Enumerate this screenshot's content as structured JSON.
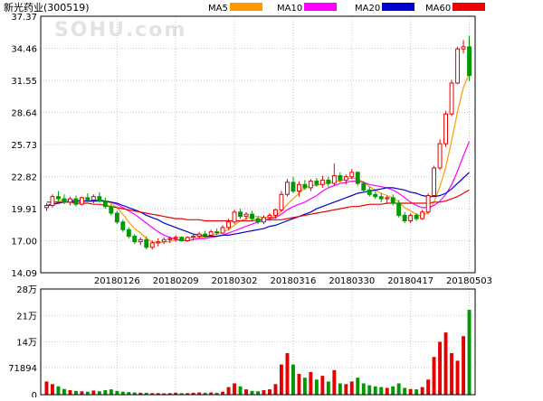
{
  "header": {
    "title": "新光药业(300519)",
    "watermark": "SOHU.com"
  },
  "legend": [
    {
      "label": "MA5",
      "color": "#ff9900"
    },
    {
      "label": "MA10",
      "color": "#ff00ff"
    },
    {
      "label": "MA20",
      "color": "#0000cc"
    },
    {
      "label": "MA60",
      "color": "#ee0000"
    }
  ],
  "colors": {
    "up": "#e60000",
    "down": "#009900",
    "grid": "#c8c8c8",
    "axis": "#000000",
    "background": "#ffffff"
  },
  "chart_data": [
    {
      "type": "candlestick",
      "title": "新光药业(300519)",
      "ylim": [
        14.09,
        37.37
      ],
      "y_ticks": [
        "37.37",
        "34.46",
        "31.55",
        "28.64",
        "25.73",
        "22.82",
        "19.91",
        "17.00",
        "14.09"
      ],
      "x_ticks": [
        {
          "index": 12,
          "label": "20180126"
        },
        {
          "index": 22,
          "label": "20180209"
        },
        {
          "index": 32,
          "label": "20180302"
        },
        {
          "index": 42,
          "label": "20180316"
        },
        {
          "index": 52,
          "label": "20180330"
        },
        {
          "index": 62,
          "label": "20180417"
        },
        {
          "index": 72,
          "label": "20180503"
        }
      ],
      "ohlc": [
        [
          20.0,
          20.4,
          19.7,
          20.2
        ],
        [
          20.2,
          21.2,
          20.0,
          21.0
        ],
        [
          21.0,
          21.5,
          20.6,
          20.8
        ],
        [
          20.8,
          21.2,
          20.3,
          20.5
        ],
        [
          20.5,
          21.0,
          20.2,
          20.8
        ],
        [
          20.8,
          21.1,
          20.1,
          20.3
        ],
        [
          20.3,
          21.0,
          20.2,
          20.9
        ],
        [
          20.9,
          21.3,
          20.5,
          20.7
        ],
        [
          20.7,
          21.2,
          20.4,
          21.0
        ],
        [
          21.0,
          21.4,
          20.5,
          20.6
        ],
        [
          20.6,
          20.9,
          19.9,
          20.1
        ],
        [
          20.1,
          20.3,
          19.3,
          19.5
        ],
        [
          19.5,
          19.7,
          18.5,
          18.7
        ],
        [
          18.7,
          18.9,
          17.8,
          18.0
        ],
        [
          18.0,
          18.2,
          17.2,
          17.4
        ],
        [
          17.4,
          17.6,
          16.7,
          16.9
        ],
        [
          16.9,
          17.3,
          16.6,
          17.1
        ],
        [
          17.1,
          17.4,
          16.2,
          16.4
        ],
        [
          16.4,
          17.0,
          16.2,
          16.8
        ],
        [
          16.8,
          17.2,
          16.5,
          16.9
        ],
        [
          16.9,
          17.3,
          16.7,
          17.1
        ],
        [
          17.1,
          17.4,
          16.8,
          17.2
        ],
        [
          17.2,
          17.5,
          16.9,
          17.3
        ],
        [
          17.3,
          17.4,
          16.9,
          17.0
        ],
        [
          17.0,
          17.4,
          16.9,
          17.3
        ],
        [
          17.3,
          17.6,
          17.1,
          17.4
        ],
        [
          17.4,
          17.8,
          17.2,
          17.6
        ],
        [
          17.6,
          17.9,
          17.3,
          17.5
        ],
        [
          17.5,
          18.0,
          17.4,
          17.8
        ],
        [
          17.8,
          18.1,
          17.5,
          17.7
        ],
        [
          17.7,
          18.4,
          17.6,
          18.2
        ],
        [
          18.2,
          19.0,
          18.0,
          18.7
        ],
        [
          18.7,
          19.8,
          18.5,
          19.6
        ],
        [
          19.6,
          19.9,
          19.0,
          19.2
        ],
        [
          19.2,
          19.6,
          18.9,
          19.4
        ],
        [
          19.4,
          19.7,
          18.8,
          19.0
        ],
        [
          19.0,
          19.2,
          18.5,
          18.7
        ],
        [
          18.7,
          19.3,
          18.5,
          19.1
        ],
        [
          19.1,
          19.5,
          18.8,
          19.3
        ],
        [
          19.3,
          19.9,
          19.0,
          19.8
        ],
        [
          19.8,
          21.5,
          19.6,
          21.2
        ],
        [
          21.2,
          22.6,
          21.0,
          22.3
        ],
        [
          22.3,
          22.8,
          21.3,
          21.5
        ],
        [
          21.5,
          22.4,
          21.0,
          22.1
        ],
        [
          22.1,
          22.5,
          21.6,
          21.8
        ],
        [
          21.8,
          22.6,
          21.5,
          22.4
        ],
        [
          22.4,
          22.7,
          21.9,
          22.1
        ],
        [
          22.1,
          22.9,
          21.8,
          22.5
        ],
        [
          22.5,
          22.8,
          21.9,
          22.2
        ],
        [
          22.2,
          24.0,
          22.0,
          22.9
        ],
        [
          22.9,
          23.2,
          22.3,
          22.5
        ],
        [
          22.5,
          23.0,
          22.1,
          22.8
        ],
        [
          22.8,
          23.5,
          22.6,
          23.2
        ],
        [
          23.2,
          23.3,
          22.0,
          22.2
        ],
        [
          22.2,
          22.4,
          21.4,
          21.6
        ],
        [
          21.6,
          21.9,
          21.0,
          21.2
        ],
        [
          21.2,
          21.5,
          20.8,
          21.0
        ],
        [
          21.0,
          21.3,
          20.5,
          20.8
        ],
        [
          20.8,
          21.1,
          20.4,
          20.9
        ],
        [
          20.9,
          21.2,
          20.2,
          20.4
        ],
        [
          20.4,
          20.7,
          19.1,
          19.3
        ],
        [
          19.3,
          19.6,
          18.6,
          18.8
        ],
        [
          18.8,
          19.5,
          18.6,
          19.3
        ],
        [
          19.3,
          19.5,
          18.8,
          19.0
        ],
        [
          19.0,
          19.8,
          18.9,
          19.6
        ],
        [
          19.6,
          21.3,
          19.4,
          21.1
        ],
        [
          21.1,
          23.8,
          21.0,
          23.6
        ],
        [
          23.6,
          26.2,
          23.4,
          25.8
        ],
        [
          25.8,
          28.8,
          25.5,
          28.5
        ],
        [
          28.5,
          31.6,
          28.3,
          31.3
        ],
        [
          31.3,
          34.6,
          31.2,
          34.4
        ],
        [
          34.4,
          35.2,
          34.0,
          34.6
        ],
        [
          34.6,
          35.6,
          31.5,
          32.0
        ]
      ],
      "ma": {
        "MA5": [
          20.1,
          20.4,
          20.6,
          20.7,
          20.7,
          20.7,
          20.6,
          20.6,
          20.7,
          20.7,
          20.6,
          20.4,
          20.0,
          19.4,
          18.7,
          18.1,
          17.7,
          17.2,
          16.9,
          16.8,
          16.9,
          16.9,
          17.1,
          17.1,
          17.2,
          17.3,
          17.3,
          17.3,
          17.5,
          17.6,
          17.8,
          18.0,
          18.4,
          18.8,
          19.0,
          19.2,
          19.2,
          19.1,
          19.1,
          19.2,
          19.7,
          20.3,
          20.8,
          21.3,
          21.8,
          22.0,
          22.0,
          22.2,
          22.2,
          22.4,
          22.4,
          22.6,
          22.7,
          22.6,
          22.3,
          21.9,
          21.6,
          21.3,
          21.1,
          20.9,
          20.5,
          20.0,
          19.7,
          19.4,
          19.2,
          19.6,
          20.5,
          21.9,
          23.7,
          26.1,
          28.7,
          30.9,
          32.2
        ],
        "MA10": [
          20.1,
          20.3,
          20.4,
          20.5,
          20.6,
          20.6,
          20.6,
          20.6,
          20.6,
          20.7,
          20.6,
          20.5,
          20.3,
          20.0,
          19.7,
          19.4,
          19.0,
          18.6,
          18.2,
          17.8,
          17.5,
          17.3,
          17.1,
          17.0,
          17.0,
          17.1,
          17.2,
          17.2,
          17.3,
          17.4,
          17.5,
          17.7,
          17.9,
          18.1,
          18.3,
          18.5,
          18.7,
          18.8,
          19.0,
          19.1,
          19.4,
          19.8,
          20.1,
          20.3,
          20.5,
          20.8,
          21.1,
          21.5,
          21.8,
          22.0,
          22.2,
          22.3,
          22.4,
          22.4,
          22.3,
          22.1,
          22.0,
          21.9,
          21.8,
          21.6,
          21.3,
          20.9,
          20.5,
          20.2,
          20.0,
          20.0,
          20.2,
          20.6,
          21.2,
          22.1,
          23.3,
          24.7,
          26.0
        ],
        "MA20": [
          20.2,
          20.3,
          20.4,
          20.5,
          20.5,
          20.6,
          20.6,
          20.6,
          20.6,
          20.6,
          20.6,
          20.5,
          20.4,
          20.2,
          20.0,
          19.8,
          19.6,
          19.3,
          19.1,
          18.9,
          18.6,
          18.4,
          18.2,
          18.0,
          17.8,
          17.6,
          17.5,
          17.4,
          17.4,
          17.4,
          17.5,
          17.5,
          17.6,
          17.7,
          17.8,
          17.9,
          18.0,
          18.1,
          18.3,
          18.4,
          18.6,
          18.8,
          19.0,
          19.2,
          19.4,
          19.6,
          19.9,
          20.1,
          20.3,
          20.5,
          20.7,
          20.9,
          21.1,
          21.3,
          21.4,
          21.5,
          21.6,
          21.7,
          21.8,
          21.8,
          21.7,
          21.6,
          21.4,
          21.3,
          21.1,
          21.0,
          21.0,
          21.1,
          21.3,
          21.7,
          22.2,
          22.7,
          23.2
        ],
        "MA60": [
          20.5,
          20.5,
          20.5,
          20.5,
          20.5,
          20.4,
          20.4,
          20.4,
          20.3,
          20.3,
          20.2,
          20.1,
          20.0,
          19.9,
          19.8,
          19.7,
          19.6,
          19.5,
          19.4,
          19.3,
          19.2,
          19.1,
          19.0,
          19.0,
          18.9,
          18.9,
          18.9,
          18.8,
          18.8,
          18.8,
          18.8,
          18.8,
          18.8,
          18.8,
          18.8,
          18.8,
          18.9,
          18.9,
          18.9,
          18.9,
          18.9,
          19.0,
          19.1,
          19.2,
          19.3,
          19.4,
          19.5,
          19.6,
          19.7,
          19.8,
          19.9,
          20.0,
          20.1,
          20.1,
          20.2,
          20.3,
          20.3,
          20.3,
          20.4,
          20.4,
          20.4,
          20.4,
          20.4,
          20.4,
          20.4,
          20.4,
          20.5,
          20.5,
          20.6,
          20.8,
          21.0,
          21.3,
          21.6
        ]
      }
    },
    {
      "type": "bar",
      "title": "",
      "ylabel": "",
      "ylim": [
        0,
        280000
      ],
      "y_ticks": [
        {
          "value": 280000,
          "label": "28万"
        },
        {
          "value": 210000,
          "label": "21万"
        },
        {
          "value": 140000,
          "label": "14万"
        },
        {
          "value": 71894,
          "label": "71894"
        },
        {
          "value": 0,
          "label": "0"
        }
      ],
      "values": [
        35000,
        28000,
        22000,
        15000,
        12000,
        10000,
        9000,
        8000,
        11000,
        9000,
        12000,
        14000,
        10000,
        8000,
        7000,
        6000,
        5000,
        5000,
        4000,
        4000,
        3500,
        4000,
        5000,
        4000,
        4000,
        5000,
        6000,
        5000,
        6000,
        5000,
        8000,
        20000,
        30000,
        22000,
        14000,
        10000,
        9000,
        12000,
        14000,
        28000,
        80000,
        110000,
        80000,
        55000,
        45000,
        60000,
        40000,
        50000,
        35000,
        65000,
        30000,
        28000,
        35000,
        45000,
        30000,
        25000,
        22000,
        20000,
        18000,
        22000,
        30000,
        18000,
        15000,
        14000,
        20000,
        40000,
        100000,
        140000,
        165000,
        110000,
        90000,
        155000,
        225000
      ]
    }
  ]
}
